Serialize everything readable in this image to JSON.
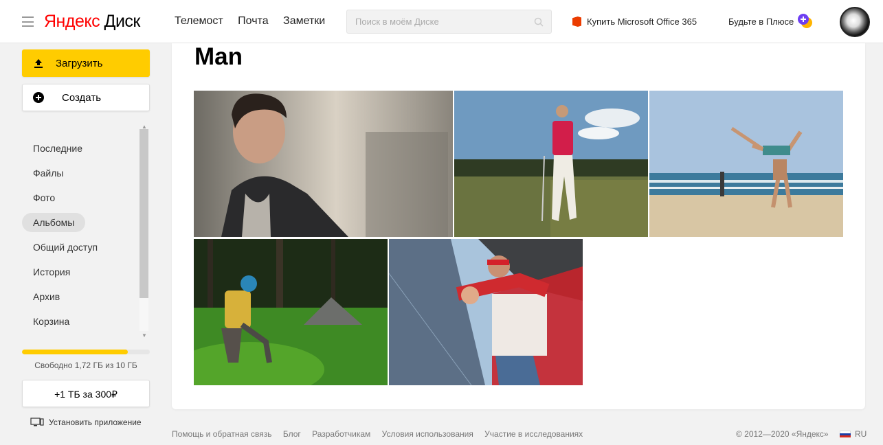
{
  "header": {
    "logo_part1": "Яндекс",
    "logo_part2": "Диск",
    "nav": [
      "Телемост",
      "Почта",
      "Заметки"
    ],
    "search_placeholder": "Поиск в моём Диске",
    "office_label": "Купить Microsoft Office 365",
    "plus_label": "Будьте в Плюсе"
  },
  "sidebar": {
    "upload_label": "Загрузить",
    "create_label": "Создать",
    "items": [
      {
        "label": "Последние"
      },
      {
        "label": "Файлы"
      },
      {
        "label": "Фото"
      },
      {
        "label": "Альбомы",
        "active": true
      },
      {
        "label": "Общий доступ"
      },
      {
        "label": "История"
      },
      {
        "label": "Архив"
      },
      {
        "label": "Корзина"
      }
    ],
    "storage_used_fraction": 0.828,
    "storage_text": "Свободно 1,72 ГБ из 10 ГБ",
    "buy_label": "+1 ТБ за 300₽",
    "install_label": "Установить приложение"
  },
  "main": {
    "album_title": "Man",
    "photos": [
      {
        "subject": "portrait-man-photo"
      },
      {
        "subject": "golfer-photo"
      },
      {
        "subject": "beach-handstand-photo"
      },
      {
        "subject": "camper-forest-photo"
      },
      {
        "subject": "father-son-superhero-photo"
      }
    ]
  },
  "footer": {
    "links": [
      "Помощь и обратная связь",
      "Блог",
      "Разработчикам",
      "Условия использования",
      "Участие в исследованиях"
    ],
    "copyright": "© 2012—2020 «Яндекс»",
    "lang": "RU"
  },
  "colors": {
    "accent": "#ffcc00",
    "logo_red": "#ff0000",
    "office_orange": "#eb3c00"
  }
}
